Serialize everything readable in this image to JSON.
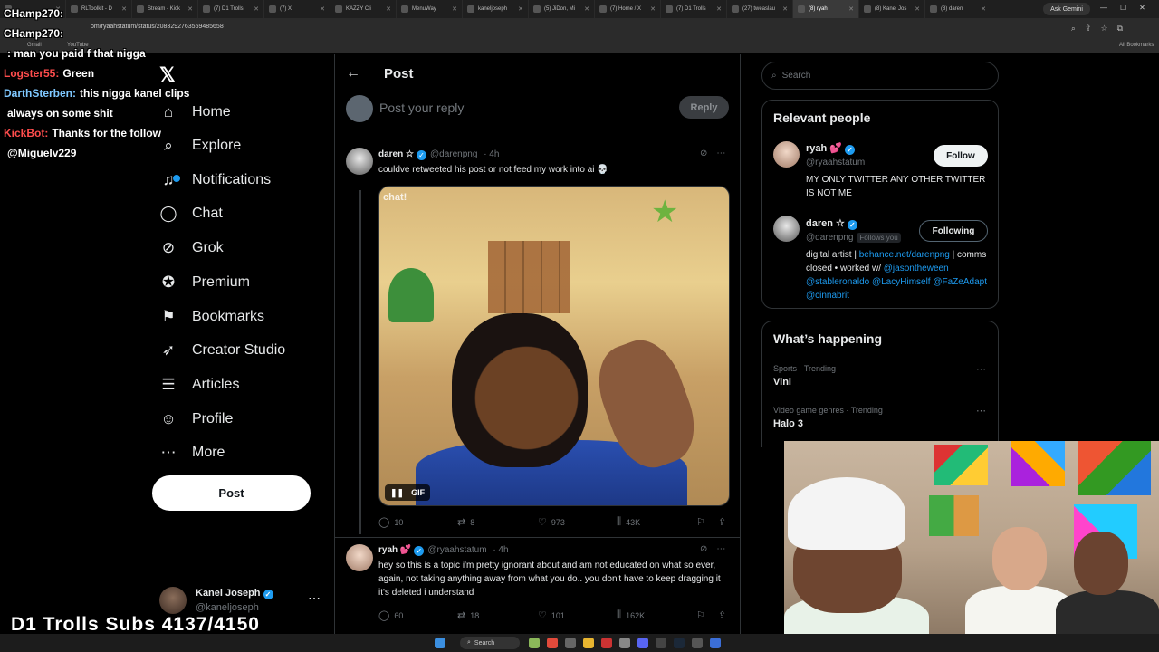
{
  "browser": {
    "tabs": [
      {
        "label": "",
        "active": false
      },
      {
        "label": "RLToolkit - D",
        "active": false
      },
      {
        "label": "Stream - Kick",
        "active": false
      },
      {
        "label": "(7) D1 Trolls",
        "active": false
      },
      {
        "label": "(7) X",
        "active": false
      },
      {
        "label": "KAZZY Cli",
        "active": false
      },
      {
        "label": "MenuWay",
        "active": false
      },
      {
        "label": "kaneljoseph",
        "active": false
      },
      {
        "label": "(5) JiDon, Mi",
        "active": false
      },
      {
        "label": "(7) Home / X",
        "active": false
      },
      {
        "label": "(7) D1 Trolls",
        "active": false
      },
      {
        "label": "(27) tweaslau",
        "active": false
      },
      {
        "label": "(8) ryah",
        "active": true
      },
      {
        "label": "(8) Kanel Jos",
        "active": false
      },
      {
        "label": "(8) daren",
        "active": false
      }
    ],
    "ask_gemini": "Ask Gemini",
    "url": "om/ryaahstatum/status/2083292763559485658",
    "bookmarks": {
      "gmail": "Gmail",
      "youtube": "YouTube",
      "all": "All Bookmarks"
    }
  },
  "nav": {
    "items": [
      {
        "label": "Home",
        "icon": "home-icon"
      },
      {
        "label": "Explore",
        "icon": "search-icon"
      },
      {
        "label": "Notifications",
        "icon": "bell-icon"
      },
      {
        "label": "Chat",
        "icon": "chat-icon"
      },
      {
        "label": "Grok",
        "icon": "grok-icon"
      },
      {
        "label": "Premium",
        "icon": "premium-icon"
      },
      {
        "label": "Bookmarks",
        "icon": "bookmark-icon"
      },
      {
        "label": "Creator Studio",
        "icon": "rocket-icon"
      },
      {
        "label": "Articles",
        "icon": "articles-icon"
      },
      {
        "label": "Profile",
        "icon": "person-icon"
      },
      {
        "label": "More",
        "icon": "more-icon"
      }
    ],
    "post_button": "Post",
    "account": {
      "name": "Kanel Joseph",
      "handle": "@kaneljoseph"
    }
  },
  "main": {
    "title": "Post",
    "reply_placeholder": "Post your reply",
    "reply_button": "Reply",
    "tweets": [
      {
        "name": "daren ☆",
        "handle": "@darenpng",
        "time": "· 4h",
        "text": "couldve retweeted his post or not feed my work into ai 💀",
        "media_badge": "GIF",
        "media_overlay_text": "chat!",
        "replies": "10",
        "reposts": "8",
        "likes": "973",
        "views": "43K"
      },
      {
        "name": "ryah 💕",
        "handle": "@ryaahstatum",
        "time": "· 4h",
        "text": "hey so this is a topic i'm pretty ignorant about and am not educated on what so ever, again, not taking anything away from what you do.. you don't have to keep dragging it it's deleted i understand",
        "replies": "60",
        "reposts": "18",
        "likes": "101",
        "views": "162K"
      }
    ]
  },
  "right": {
    "search_placeholder": "Search",
    "relevant_title": "Relevant people",
    "people": [
      {
        "name": "ryah 💕",
        "handle": "@ryaahstatum",
        "bio": "MY ONLY TWITTER ANY OTHER TWITTER IS NOT ME",
        "button": "Follow"
      },
      {
        "name": "daren ☆",
        "handle": "@darenpng",
        "follows_you": "Follows you",
        "bio_pre": "digital artist | ",
        "bio_link": "behance.net/darenpng",
        "bio_mid": " | comms closed • worked w/ ",
        "bio_mentions": "@jasontheween @stableronaldo @LacyHimself @FaZeAdapt @cinnabrit",
        "button": "Following"
      }
    ],
    "happening_title": "What’s happening",
    "trends": [
      {
        "meta": "Sports · Trending",
        "name": "Vini"
      },
      {
        "meta": "Video game genres · Trending",
        "name": "Halo 3"
      }
    ]
  },
  "overlay": {
    "chat": [
      {
        "user": "CHamp270:",
        "msg": "",
        "color": "white"
      },
      {
        "user": "CHamp270:",
        "msg": "",
        "color": "white"
      },
      {
        "user": "",
        "msg": ": man you paid f that nigga",
        "color": "red"
      },
      {
        "user": "Logster55:",
        "msg": "Green",
        "color": "red"
      },
      {
        "user": "DarthSterben:",
        "msg": "this nigga kanel clips",
        "color": "blue"
      },
      {
        "user": "",
        "msg": "always on some shit",
        "color": "white"
      },
      {
        "user": "KickBot:",
        "msg": "Thanks for the follow",
        "color": "red"
      },
      {
        "user": "",
        "msg": "@Miguelv229",
        "color": "white"
      }
    ],
    "subs_counter": "D1 Trolls Subs 4137/4150"
  },
  "taskbar": {
    "search": "Search"
  }
}
